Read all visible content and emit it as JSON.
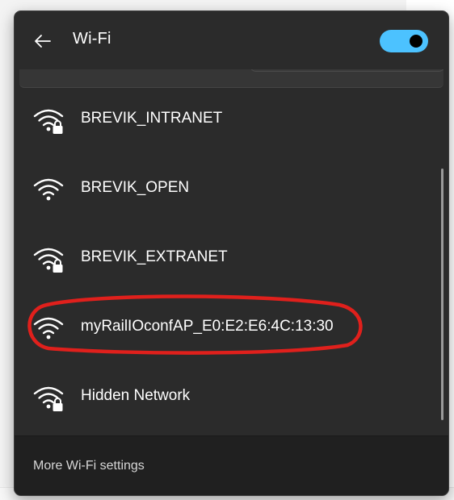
{
  "panel": {
    "title": "Wi-Fi",
    "wifi_enabled": true,
    "back_icon": "arrow-left-icon"
  },
  "networks": [
    {
      "name": "BREVIK_INTRANET",
      "secured": true,
      "icon": "wifi-secured-icon"
    },
    {
      "name": "BREVIK_OPEN",
      "secured": false,
      "icon": "wifi-icon"
    },
    {
      "name": "BREVIK_EXTRANET",
      "secured": true,
      "icon": "wifi-secured-icon"
    },
    {
      "name": "myRailIOconfAP_E0:E2:E6:4C:13:30",
      "secured": false,
      "icon": "wifi-icon"
    },
    {
      "name": "Hidden Network",
      "secured": true,
      "icon": "wifi-secured-icon"
    }
  ],
  "footer": {
    "more_settings_label": "More Wi-Fi settings"
  },
  "colors": {
    "panel_bg": "#2b2b2b",
    "footer_bg": "#202020",
    "accent": "#4cc2ff",
    "annotation": "#e0201c"
  }
}
